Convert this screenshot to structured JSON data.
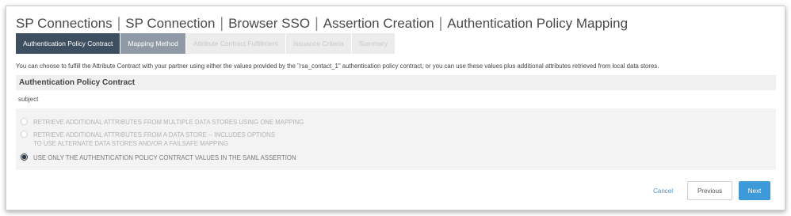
{
  "breadcrumb": {
    "items": [
      "SP Connections",
      "SP Connection",
      "Browser SSO",
      "Assertion Creation",
      "Authentication Policy Mapping"
    ],
    "separator": "|"
  },
  "tabs": [
    {
      "label": "Authentication Policy Contract",
      "state": "active"
    },
    {
      "label": "Mapping Method",
      "state": "visited"
    },
    {
      "label": "Attribute Contract Fulfillment",
      "state": "disabled"
    },
    {
      "label": "Issuance Criteria",
      "state": "disabled"
    },
    {
      "label": "Summary",
      "state": "disabled"
    }
  ],
  "description": "You can choose to fulfill the Attribute Contract with your partner using either the values provided by the \"rsa_contact_1\" authentication policy contract, or you can use these values plus additional attributes retrieved from local data stores.",
  "section": {
    "title": "Authentication Policy Contract",
    "subject_label": "subject"
  },
  "options": [
    {
      "line1": "RETRIEVE ADDITIONAL ATTRIBUTES FROM MULTIPLE DATA STORES USING ONE MAPPING",
      "line2": "",
      "checked": false
    },
    {
      "line1": "RETRIEVE ADDITIONAL ATTRIBUTES FROM A DATA STORE -- INCLUDES OPTIONS",
      "line2": "TO USE ALTERNATE DATA STORES AND/OR A FAILSAFE MAPPING",
      "checked": false
    },
    {
      "line1": "USE ONLY THE AUTHENTICATION POLICY CONTRACT VALUES IN THE SAML ASSERTION",
      "line2": "",
      "checked": true
    }
  ],
  "footer": {
    "cancel_label": "Cancel",
    "previous_label": "Previous",
    "next_label": "Next"
  },
  "colors": {
    "tab_active": "#3d4f60",
    "tab_visited": "#8f9aa6",
    "next_button": "#3d9ad8",
    "cancel_link": "#4a8fd0"
  }
}
